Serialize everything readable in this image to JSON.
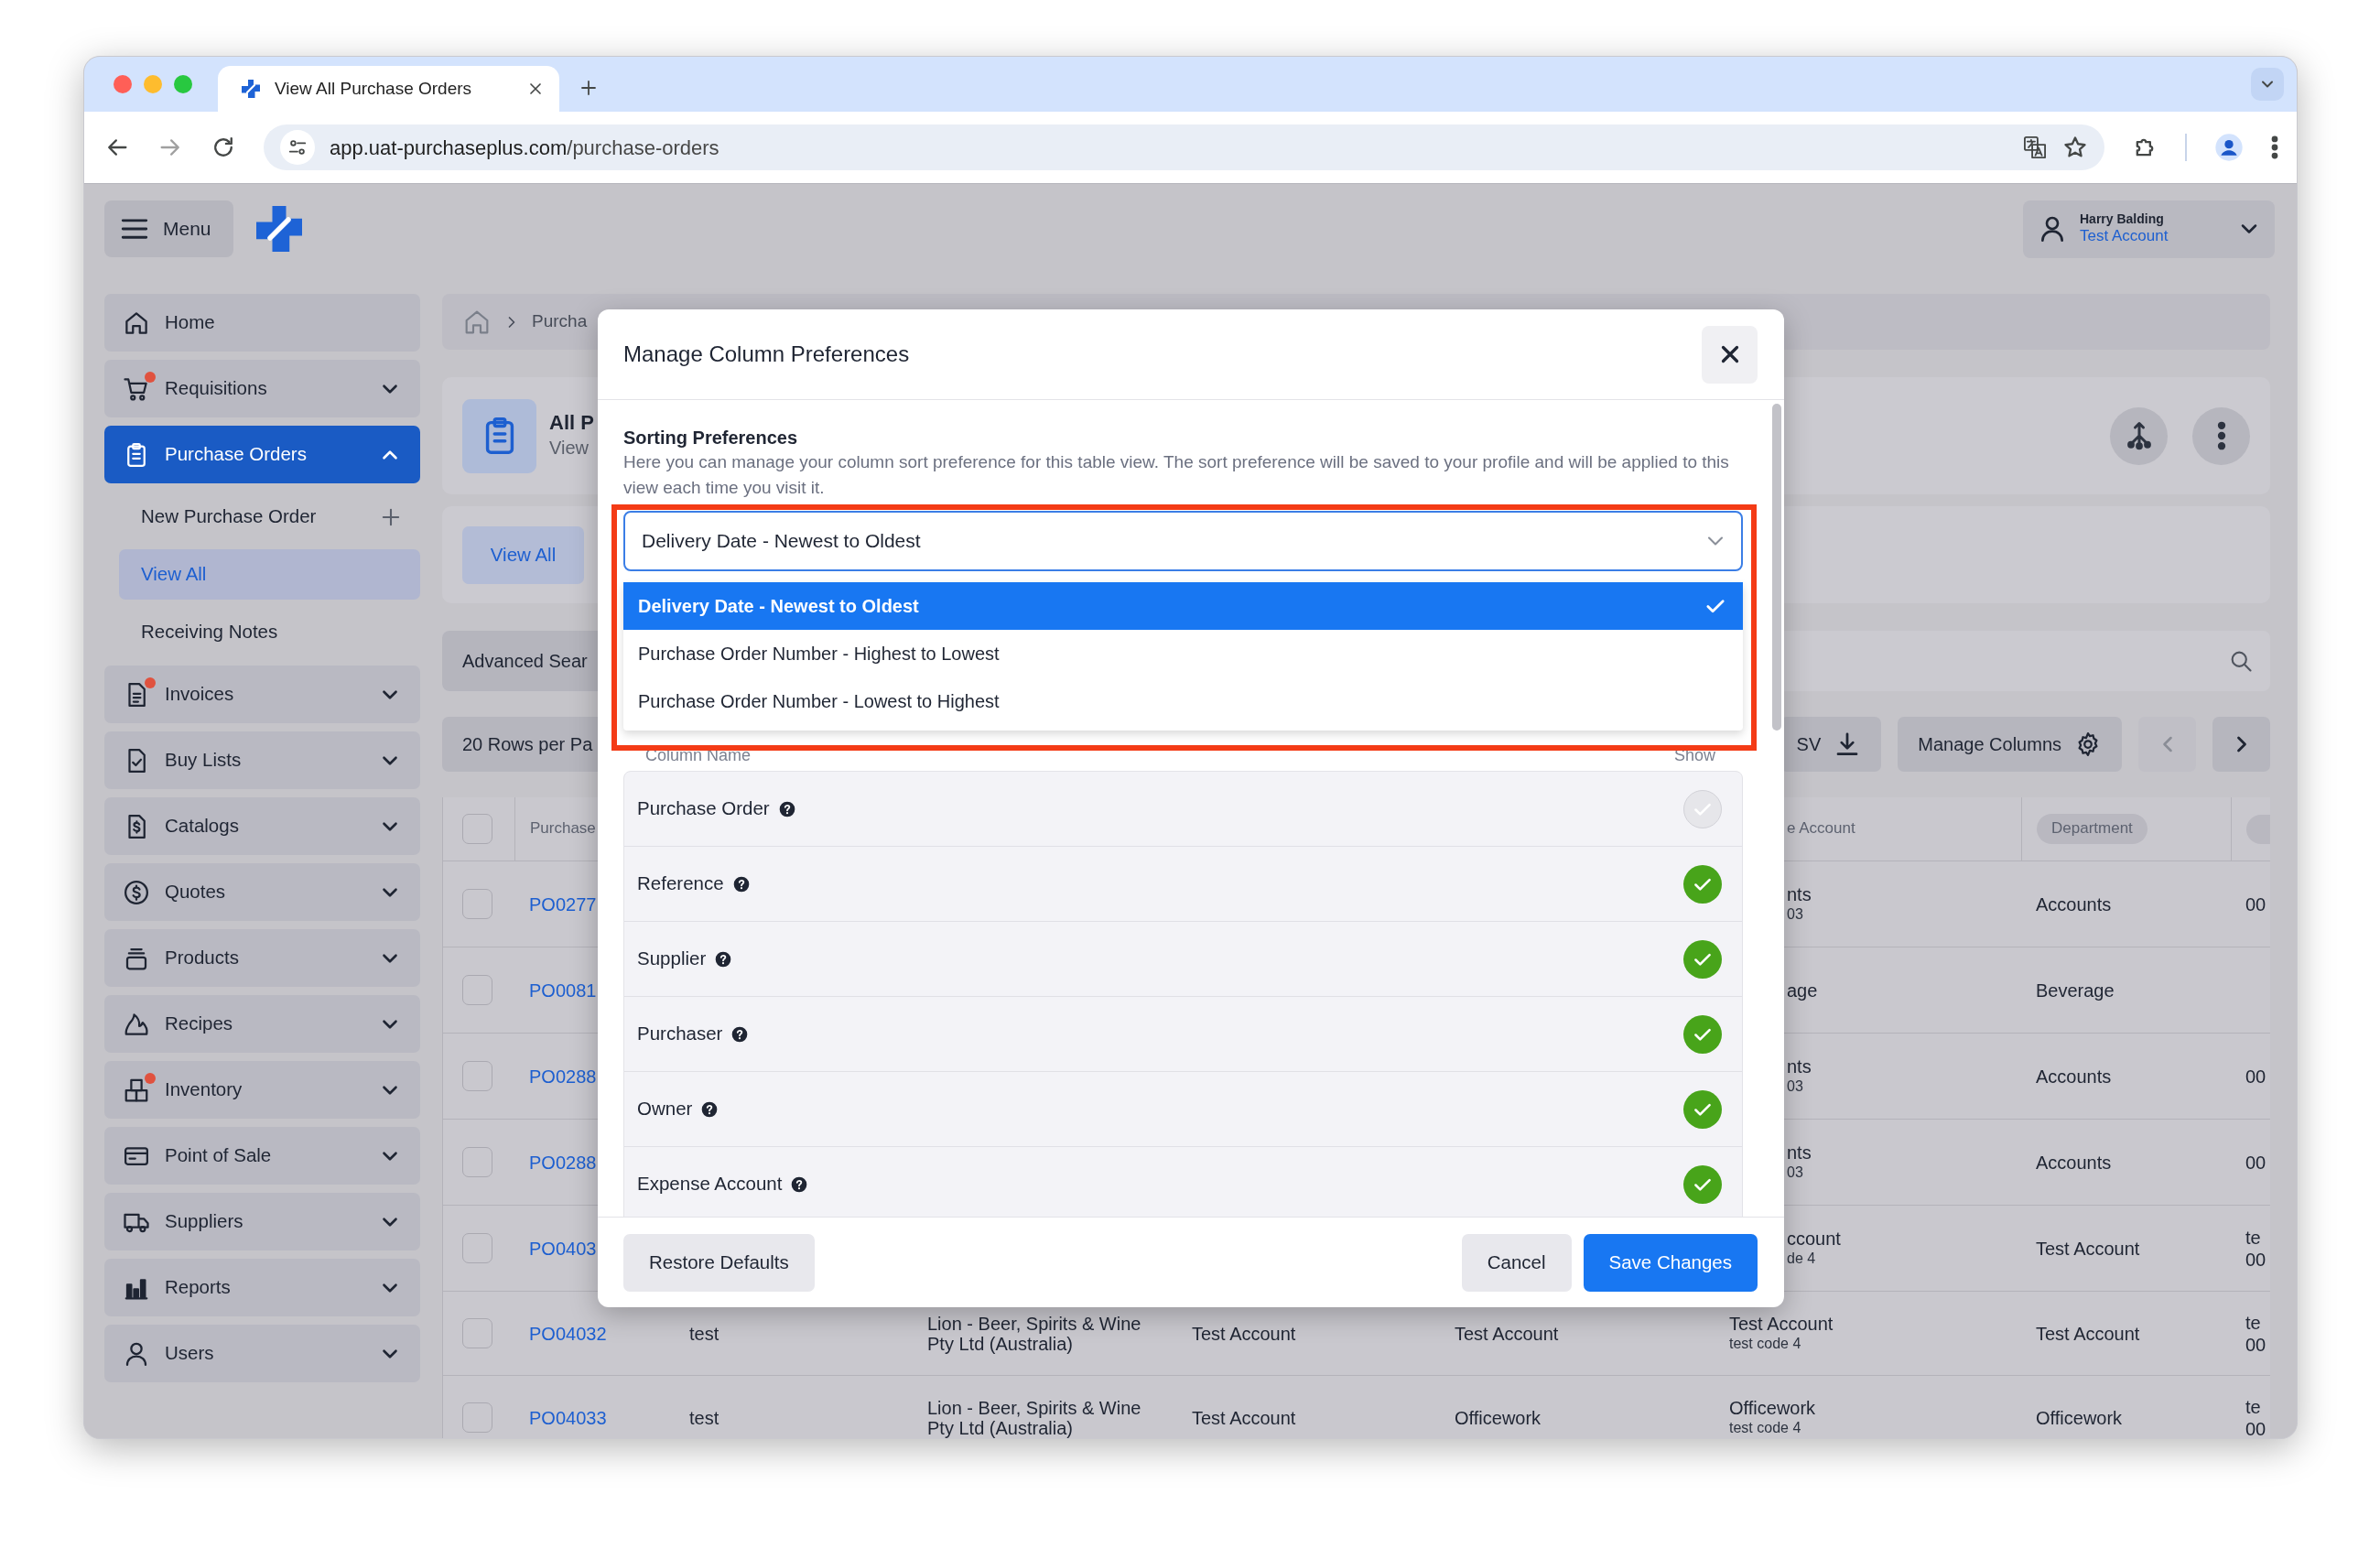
{
  "browser": {
    "tab_title": "View All Purchase Orders",
    "url_host": "app.uat-purchaseplus.com",
    "url_path": "/purchase-orders"
  },
  "header": {
    "menu_label": "Menu",
    "user_name": "Harry Balding",
    "account": "Test Account"
  },
  "sidebar": {
    "items": [
      {
        "label": "Home",
        "kind": "link",
        "selected": false,
        "alert": false
      },
      {
        "label": "Requisitions",
        "kind": "group",
        "selected": false,
        "expanded": false,
        "alert": true
      },
      {
        "label": "Purchase Orders",
        "kind": "group",
        "selected": true,
        "expanded": true,
        "alert": false,
        "children": [
          {
            "label": "New Purchase Order",
            "kind": "action",
            "selected": false
          },
          {
            "label": "View All",
            "kind": "link",
            "selected": true
          },
          {
            "label": "Receiving Notes",
            "kind": "link",
            "selected": false
          }
        ]
      },
      {
        "label": "Invoices",
        "kind": "group",
        "selected": false,
        "expanded": false,
        "alert": true
      },
      {
        "label": "Buy Lists",
        "kind": "group",
        "selected": false,
        "expanded": false,
        "alert": false
      },
      {
        "label": "Catalogs",
        "kind": "group",
        "selected": false,
        "expanded": false,
        "alert": false
      },
      {
        "label": "Quotes",
        "kind": "group",
        "selected": false,
        "expanded": false,
        "alert": false
      },
      {
        "label": "Products",
        "kind": "group",
        "selected": false,
        "expanded": false,
        "alert": false
      },
      {
        "label": "Recipes",
        "kind": "group",
        "selected": false,
        "expanded": false,
        "alert": false
      },
      {
        "label": "Inventory",
        "kind": "group",
        "selected": false,
        "expanded": false,
        "alert": true
      },
      {
        "label": "Point of Sale",
        "kind": "group",
        "selected": false,
        "expanded": false,
        "alert": false
      },
      {
        "label": "Suppliers",
        "kind": "group",
        "selected": false,
        "expanded": false,
        "alert": false
      },
      {
        "label": "Reports",
        "kind": "group",
        "selected": false,
        "expanded": false,
        "alert": false
      },
      {
        "label": "Users",
        "kind": "group",
        "selected": false,
        "expanded": false,
        "alert": false
      }
    ]
  },
  "breadcrumb": [
    "Purcha"
  ],
  "page_header": {
    "title": "All P",
    "subtitle": "View"
  },
  "tabs": [
    {
      "label": "View All",
      "selected": true
    }
  ],
  "search": {
    "advanced_label": "Advanced Sear"
  },
  "toolbar": {
    "rows_label": "20 Rows per Pa",
    "export_label": "SV",
    "manage_label": "Manage Columns"
  },
  "table": {
    "all_selected": false,
    "columns": [
      {
        "label": "Purchase",
        "kind": "plain"
      },
      {
        "label": "e Account",
        "kind": "plain"
      },
      {
        "label": "Department",
        "kind": "pill"
      }
    ],
    "rows": [
      {
        "kind": "covered",
        "selected": false,
        "po": "PO0277",
        "expense": {
          "name": "nts",
          "code": "03"
        },
        "department": "Accounts",
        "column_8": [
          "00"
        ]
      },
      {
        "kind": "covered",
        "selected": false,
        "po": "PO0081",
        "expense": {
          "name": "age"
        },
        "department": "Beverage"
      },
      {
        "kind": "covered",
        "selected": false,
        "po": "PO0288",
        "expense": {
          "name": "nts",
          "code": "03"
        },
        "department": "Accounts",
        "column_8": [
          "00"
        ]
      },
      {
        "kind": "covered",
        "selected": false,
        "po": "PO0288",
        "expense": {
          "name": "nts",
          "code": "03"
        },
        "department": "Accounts",
        "column_8": [
          "00"
        ]
      },
      {
        "kind": "covered",
        "selected": false,
        "po": "PO0403",
        "expense": {
          "name": "ccount",
          "code": "de 4"
        },
        "department": "Test Account",
        "column_8": [
          "te",
          "00"
        ]
      },
      {
        "kind": "full",
        "selected": false,
        "po": "PO04032",
        "reference": "test",
        "supplier": "Lion - Beer, Spirits & Wine Pty Ltd (Australia)",
        "purchaser": "Test Account",
        "owner": "Test Account",
        "expense": {
          "name": "Test Account",
          "code": "test code 4"
        },
        "department": "Test Account",
        "column_8": [
          "te",
          "00"
        ]
      },
      {
        "kind": "full",
        "selected": false,
        "po": "PO04033",
        "reference": "test",
        "supplier": "Lion - Beer, Spirits & Wine Pty Ltd (Australia)",
        "purchaser": "Test Account",
        "owner": "Officework",
        "expense": {
          "name": "Officework",
          "code": "test code 4"
        },
        "department": "Officework",
        "column_8": [
          "te",
          "00"
        ]
      }
    ]
  },
  "modal": {
    "title": "Manage Column Preferences",
    "section_title": "Sorting Preferences",
    "description": "Here you can manage your column sort preference for this table view. The sort preference will be saved to your profile and will be applied to this view each time you visit it.",
    "sort_select": {
      "value": "Delivery Date - Newest to Oldest",
      "expanded": true,
      "options": [
        {
          "label": "Delivery Date - Newest to Oldest",
          "selected": true
        },
        {
          "label": "Purchase Order Number - Highest to Lowest",
          "selected": false
        },
        {
          "label": "Purchase Order Number - Lowest to Highest",
          "selected": false
        }
      ]
    },
    "columns_header": {
      "name": "Column Name",
      "show": "Show"
    },
    "columns": [
      {
        "name": "Purchase Order",
        "checked": true,
        "disabled": true
      },
      {
        "name": "Reference",
        "checked": true,
        "disabled": false
      },
      {
        "name": "Supplier",
        "checked": true,
        "disabled": false
      },
      {
        "name": "Purchaser",
        "checked": true,
        "disabled": false
      },
      {
        "name": "Owner",
        "checked": true,
        "disabled": false
      },
      {
        "name": "Expense Account",
        "checked": true,
        "disabled": false
      }
    ],
    "buttons": {
      "restore": "Restore Defaults",
      "cancel": "Cancel",
      "save": "Save Changes"
    }
  }
}
